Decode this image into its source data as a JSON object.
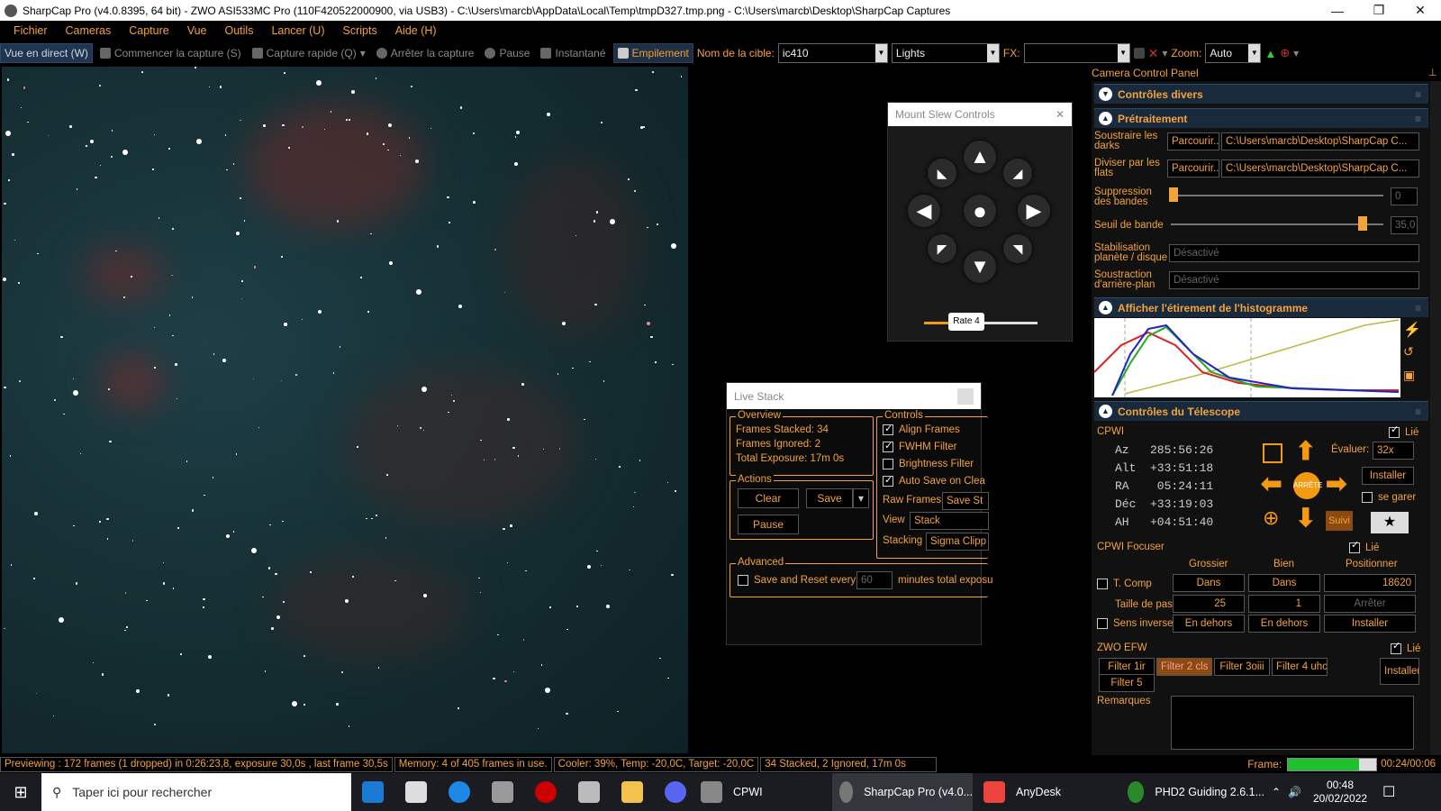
{
  "window": {
    "title": "SharpCap Pro (v4.0.8395, 64 bit) - ZWO ASI533MC Pro (110F420522000900, via USB3) - C:\\Users\\marcb\\AppData\\Local\\Temp\\tmpD327.tmp.png - C:\\Users\\marcb\\Desktop\\SharpCap Captures"
  },
  "menu": [
    "Fichier",
    "Cameras",
    "Capture",
    "Vue",
    "Outils",
    "Lancer (U)",
    "Scripts",
    "Aide (H)"
  ],
  "toolbar": {
    "live": "Vue en direct (W)",
    "start_capture": "Commencer la capture (S)",
    "quick_capture": "Capture rapide (Q)",
    "stop_capture": "Arrêter la capture",
    "pause": "Pause",
    "snapshot": "Instantané",
    "stacking": "Empilement",
    "target_label": "Nom de la cible:",
    "target_value": "ic410",
    "frame_type": "Lights",
    "fx_label": "FX:",
    "zoom_label": "Zoom:",
    "zoom_value": "Auto"
  },
  "mount": {
    "title": "Mount Slew Controls",
    "rate": "Rate 4",
    "rate_level": 0.3
  },
  "livestack": {
    "title": "Live Stack",
    "overview_title": "Overview",
    "frames_stacked": "Frames Stacked: 34",
    "frames_ignored": "Frames Ignored:  2",
    "total_exposure": "Total Exposure:   17m 0s",
    "controls_title": "Controls",
    "align": "Align Frames",
    "fwhm": "FWHM Filter",
    "brightness": "Brightness Filter",
    "autosave": "Auto Save on Clea",
    "raw_frames": "Raw Frames",
    "raw_frames_value": "Save St",
    "view_label": "View",
    "view_value": "Stack",
    "stacking_label": "Stacking",
    "stacking_value": "Sigma Clipp",
    "actions_title": "Actions",
    "clear": "Clear",
    "save": "Save",
    "pause": "Pause",
    "advanced_title": "Advanced",
    "save_reset": "Save and Reset every",
    "minutes": "60",
    "minutes_suffix": "minutes total exposu"
  },
  "panel": {
    "title": "Camera Control Panel",
    "sec_misc": "Contrôles divers",
    "sec_pre": "Prétraitement",
    "darks_label": "Soustraire les darks",
    "flats_label": "Diviser par les flats",
    "browse": "Parcourir...",
    "darks_path": "C:\\Users\\marcb\\Desktop\\SharpCap C...",
    "flats_path": "C:\\Users\\marcb\\Desktop\\SharpCap C...",
    "banding_label": "Suppression des bandes",
    "banding_value": "0",
    "threshold_label": "Seuil de bande",
    "threshold_value": "35,0",
    "stab_label": "Stabilisation planète / disque",
    "stab_value": "Désactivé",
    "bg_label": "Soustraction d'arrière-plan",
    "bg_value": "Désactivé",
    "sec_hist": "Afficher l'étirement de l'histogramme",
    "sec_tel": "Contrôles du Télescope",
    "cpwi": "CPWI",
    "linked": "Lié",
    "az": "Az   285:56:26",
    "alt": "Alt  +33:51:18",
    "ra": "RA    05:24:11",
    "dec": "Déc  +33:19:03",
    "ah": "AH   +04:51:40",
    "rate_label": "Évaluer:",
    "rate_value": "32x",
    "install": "Installer",
    "park": "se garer",
    "stop": "ARRÊTE",
    "track": "Suivi",
    "focuser": "CPWI Focuser",
    "coarse": "Grossier",
    "fine": "Bien",
    "positioner": "Positionner",
    "tcomp": "T. Comp",
    "in": "Dans",
    "out": "En dehors",
    "position": "18620",
    "step_label": "Taille de pas",
    "step_coarse": "25",
    "step_fine": "1",
    "stop_focus": "Arrêter",
    "reverse": "Sens inverse",
    "efw": "ZWO EFW",
    "filters": [
      "Filter 1ir",
      "Filter 2 cls",
      "Filter 3oiii",
      "Filter 4 uhc",
      "Filter 5"
    ],
    "notes": "Remarques"
  },
  "status": {
    "preview": "Previewing : 172 frames (1 dropped) in 0:26:23,8, exposure 30,0s , last frame 30,5s",
    "memory": "Memory: 4 of 405 frames in use.",
    "cooler": "Cooler: 39%, Temp: -20,0C, Target: -20,0C",
    "stacked": "34 Stacked, 2 Ignored, 17m 0s",
    "frame_label": "Frame:",
    "frame_progress": 0.8,
    "frame_time": "00:24/00:06"
  },
  "taskbar": {
    "search": "Taper ici pour rechercher",
    "cpwi": "CPWI",
    "sharpcap": "SharpCap Pro (v4.0...",
    "anydesk": "AnyDesk",
    "phd2": "PHD2 Guiding 2.6.1...",
    "time": "00:48",
    "date": "20/02/2022"
  }
}
